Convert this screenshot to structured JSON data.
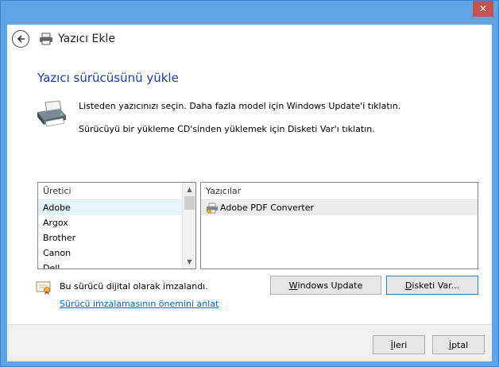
{
  "window": {
    "close_label": "✕"
  },
  "header": {
    "title": "Yazıcı Ekle"
  },
  "main": {
    "page_title": "Yazıcı sürücüsünü yükle",
    "line1": "Listeden yazıcınızı seçin. Daha fazla model için Windows Update'i tıklatın.",
    "line2": "Sürücüyü bir yükleme CD'sinden yüklemek için Disketi Var'ı tıklatın."
  },
  "manufacturers": {
    "header": "Üretici",
    "items": [
      "Adobe",
      "Argox",
      "Brother",
      "Canon",
      "Dell"
    ],
    "selected": "Adobe"
  },
  "printers": {
    "header": "Yazıcılar",
    "items": [
      "Adobe PDF Converter"
    ]
  },
  "signature": {
    "text": "Bu sürücü dijital olarak imzalandı.",
    "link": "Sürücü imzalamasının önemini anlat"
  },
  "buttons": {
    "windows_update_first": "W",
    "windows_update_rest": "indows Update",
    "have_disk_first": "D",
    "have_disk_rest": "isketi Var...",
    "next_first": "İ",
    "next_rest": "leri",
    "cancel_first": "İ",
    "cancel_rest": "ptal"
  },
  "colors": {
    "title_blue": "#1a3e9f",
    "link_blue": "#0066cc",
    "window_frame": "#5ea4e6",
    "close_red": "#c75050"
  },
  "icons": {
    "back": "back-arrow-icon",
    "printer": "printer-icon",
    "signature": "certificate-icon"
  }
}
